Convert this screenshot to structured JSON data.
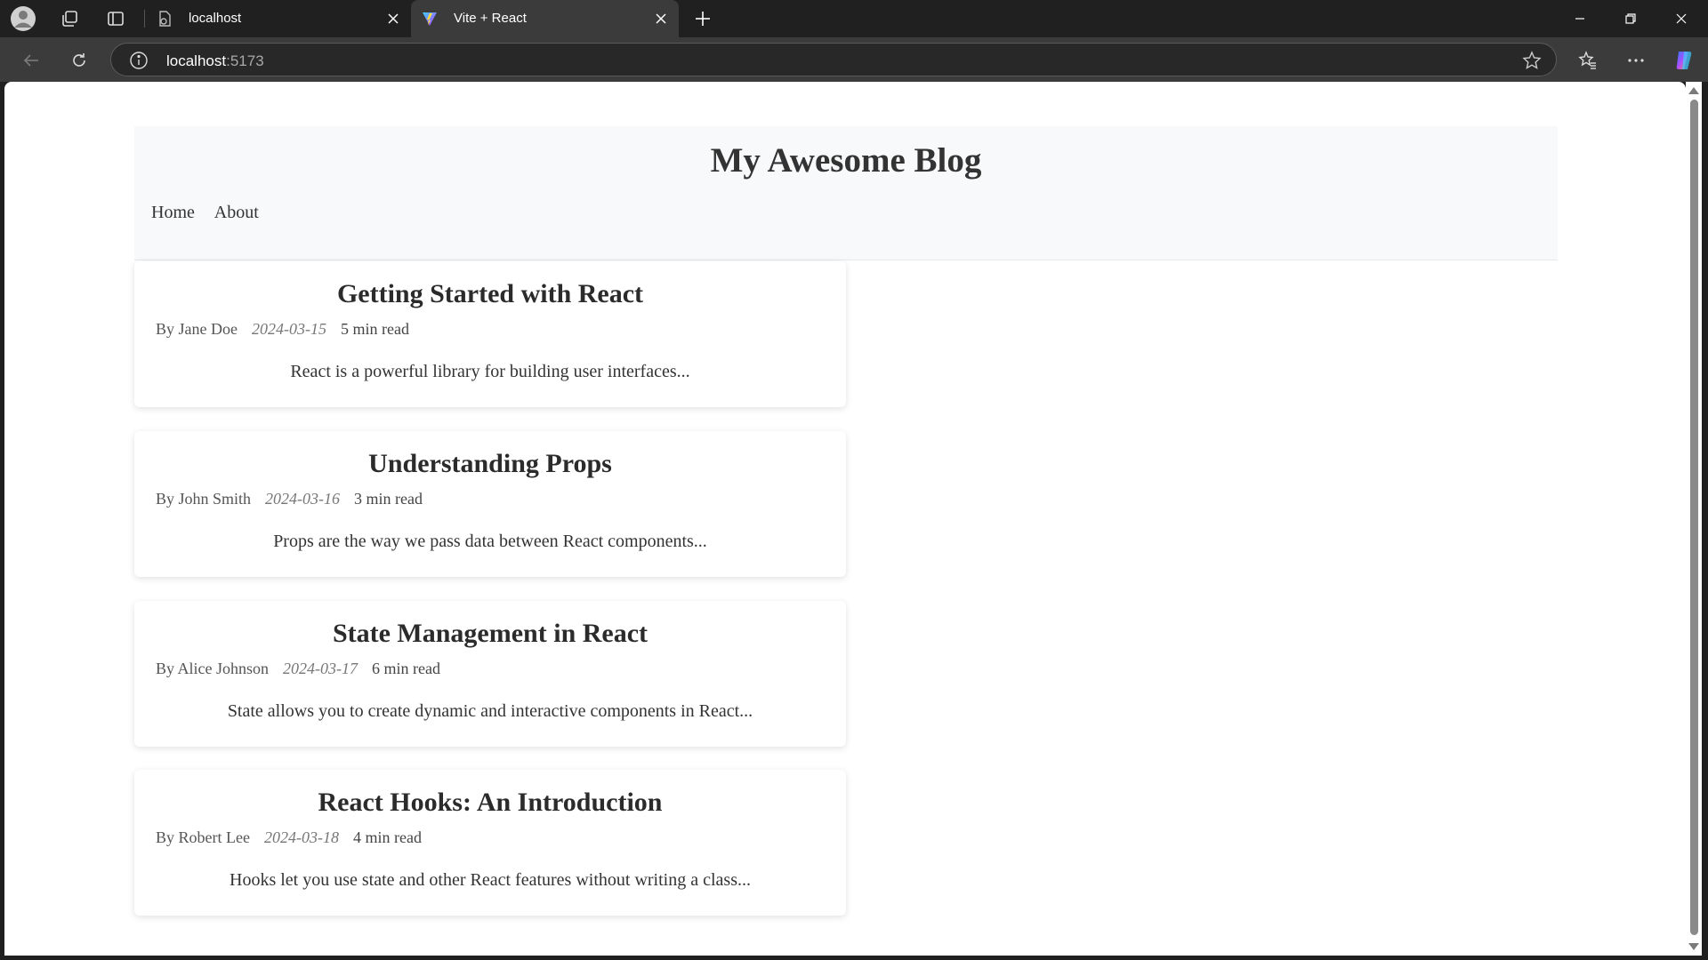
{
  "browser": {
    "tabs": [
      {
        "title": "localhost",
        "active": false
      },
      {
        "title": "Vite + React",
        "active": true
      }
    ],
    "url_host": "localhost",
    "url_port": ":5173",
    "colors": {
      "chrome_bg": "#202020",
      "toolbar_bg": "#3b3b3b"
    }
  },
  "blog": {
    "title": "My Awesome Blog",
    "nav": [
      "Home",
      "About"
    ],
    "posts": [
      {
        "title": "Getting Started with React",
        "author": "By Jane Doe",
        "date": "2024-03-15",
        "read_time": "5 min read",
        "excerpt": "React is a powerful library for building user interfaces..."
      },
      {
        "title": "Understanding Props",
        "author": "By John Smith",
        "date": "2024-03-16",
        "read_time": "3 min read",
        "excerpt": "Props are the way we pass data between React components..."
      },
      {
        "title": "State Management in React",
        "author": "By Alice Johnson",
        "date": "2024-03-17",
        "read_time": "6 min read",
        "excerpt": "State allows you to create dynamic and interactive components in React..."
      },
      {
        "title": "React Hooks: An Introduction",
        "author": "By Robert Lee",
        "date": "2024-03-18",
        "read_time": "4 min read",
        "excerpt": "Hooks let you use state and other React features without writing a class..."
      }
    ]
  }
}
